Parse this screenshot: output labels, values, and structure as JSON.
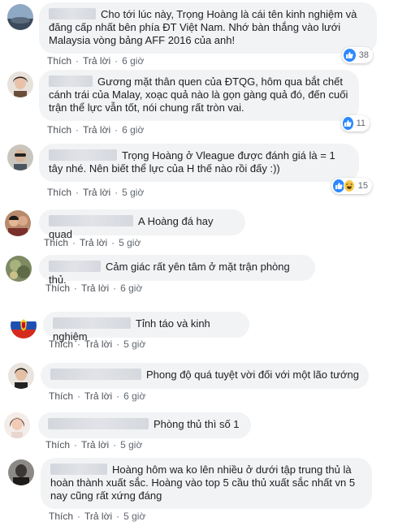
{
  "actions": {
    "like": "Thích",
    "reply": "Trả lời",
    "separator": "·"
  },
  "comments": [
    {
      "text": "Cho tới lúc này, Trọng Hoàng là cái tên kinh nghiệm và đăng cấp nhất bên phía ĐT Việt Nam. Nhớ bàn thắng vào lưới Malaysia vòng bảng AFF 2016 của anh!",
      "time": "6 giờ",
      "reactions": "38"
    },
    {
      "text": "Gương mặt thân quen của ĐTQG, hôm qua bắt chết cánh trái của Malay, xoạc quả nào là gọn gàng quả đó, đến cuối trận thể lực vẫn tốt, nói chung rất tròn vai.",
      "time": "6 giờ",
      "reactions": "11"
    },
    {
      "text": "Trọng Hoàng ở Vleague được đánh giá là = 1 tây nhé. Nên biết thể lực của H thế nào rồi đấy :))",
      "time": "5 giờ",
      "reactions": "15"
    },
    {
      "text": "A Hoàng đá hay quad",
      "time": "5 giờ"
    },
    {
      "text": "Cảm giác rất yên tâm ở mặt trận phòng thủ.",
      "time": "6 giờ"
    },
    {
      "text": "Tỉnh táo và kinh nghiệm",
      "time": "5 giờ"
    },
    {
      "text": "Phong độ quá tuyệt vời đối với một lão tướng",
      "time": "6 giờ"
    },
    {
      "text": "Phòng thủ thì số 1",
      "time": "5 giờ"
    },
    {
      "text": "Hoàng hôm wa ko lên nhiều ở dưới tập trung thủ là hoàn thành xuất sắc. Hoàng vào top 5 cầu thủ xuất sắc nhất vn 5 nay cũng rất xứng đáng",
      "time": "5 giờ"
    }
  ],
  "colors": {
    "like": "#2d88ff",
    "haha": "#f7c74a",
    "bubble": "#f2f3f5"
  }
}
